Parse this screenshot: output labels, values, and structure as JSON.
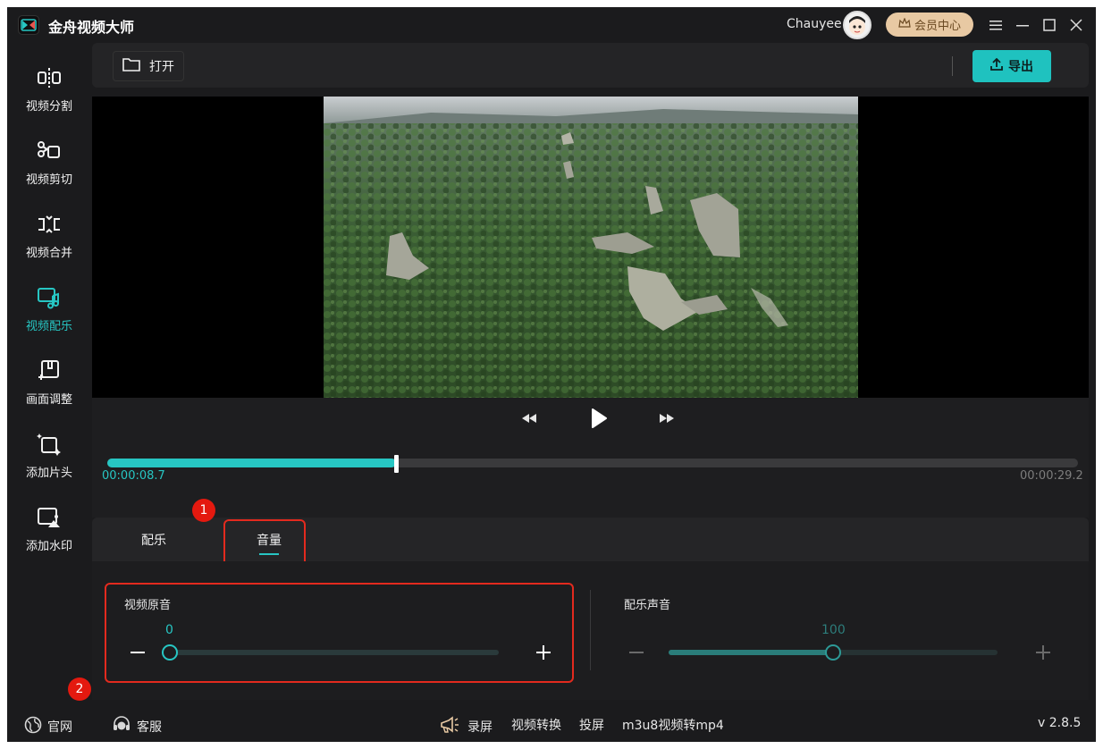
{
  "app": {
    "title": "金舟视频大师",
    "user_name": "Chauyee",
    "vip_label": "会员中心",
    "version": "v 2.8.5"
  },
  "sidebar": {
    "items": [
      {
        "label": "视频分割",
        "icon": "split-icon",
        "active": false
      },
      {
        "label": "视频剪切",
        "icon": "scissors-icon",
        "active": false
      },
      {
        "label": "视频合并",
        "icon": "merge-icon",
        "active": false
      },
      {
        "label": "视频配乐",
        "icon": "music-icon",
        "active": true
      },
      {
        "label": "画面调整",
        "icon": "crop-icon",
        "active": false
      },
      {
        "label": "添加片头",
        "icon": "intro-icon",
        "active": false
      },
      {
        "label": "添加水印",
        "icon": "watermark-icon",
        "active": false
      }
    ]
  },
  "toolbar": {
    "open_label": "打开",
    "export_label": "导出"
  },
  "player": {
    "current_time": "00:00:08.7",
    "total_time": "00:00:29.2",
    "progress_fraction": 0.297
  },
  "panel": {
    "tabs": [
      {
        "label": "配乐",
        "active": false
      },
      {
        "label": "音量",
        "active": true
      }
    ],
    "original_audio": {
      "label": "视频原音",
      "value": "0",
      "level": 0
    },
    "music_audio": {
      "label": "配乐声音",
      "value": "100",
      "level": 1.0
    }
  },
  "annotations": {
    "badge1": "1",
    "badge2": "2"
  },
  "statusbar": {
    "website_label": "官网",
    "support_label": "客服",
    "record_label": "录屏",
    "convert_label": "视频转换",
    "cast_label": "投屏",
    "m3u8_label": "m3u8视频转mp4"
  },
  "colors": {
    "accent": "#27c6c3",
    "background": "#1b1b1d",
    "highlight": "#e32a1e",
    "vip": "#e8c9a3"
  }
}
